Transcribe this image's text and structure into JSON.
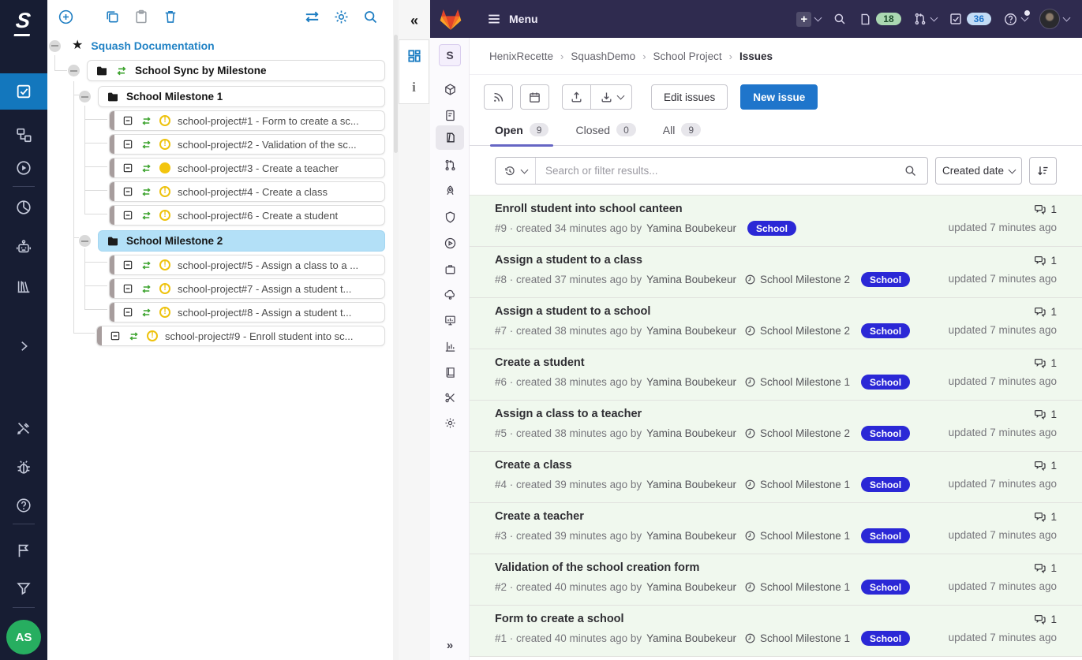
{
  "colors": {
    "gitlab_navbar": "#2f2b4f",
    "accent_blue": "#1f75cb",
    "label_blue": "#2b28d6",
    "row_green": "#f0f8ee",
    "squash_active_blue": "#1377bd",
    "tab_underline": "#6666c4",
    "sync_green": "#3da32f",
    "warn_yellow": "#eec20c"
  },
  "icons_text": {
    "collapse_left": "«",
    "expand_right": "»",
    "plus": "+",
    "info": "i",
    "breadcrumb_sep": "›"
  },
  "squash": {
    "logo_text": "S",
    "user_initials": "AS",
    "tree": {
      "root_label": "Squash Documentation",
      "sync_folder_label": "School Sync by Milestone",
      "milestones": [
        {
          "label": "School Milestone 1",
          "items": [
            {
              "label": "school-project#1 - Form to create a sc...",
              "status": "warn"
            },
            {
              "label": "school-project#2 - Validation of the sc...",
              "status": "warn"
            },
            {
              "label": "school-project#3 - Create a teacher",
              "status": "dot"
            },
            {
              "label": "school-project#4 - Create a class",
              "status": "warn"
            },
            {
              "label": "school-project#6 - Create a student",
              "status": "warn"
            }
          ]
        },
        {
          "label": "School Milestone 2",
          "items": [
            {
              "label": "school-project#5 - Assign a class to a ...",
              "status": "warn"
            },
            {
              "label": "school-project#7 - Assign a student t...",
              "status": "warn"
            },
            {
              "label": "school-project#8 - Assign a student t...",
              "status": "warn"
            }
          ]
        }
      ],
      "outer_item": {
        "label": "school-project#9 - Enroll student into sc...",
        "status": "warn"
      }
    }
  },
  "gitlab": {
    "navbar": {
      "menu_label": "Menu",
      "issues_count": "18",
      "todos_count": "36"
    },
    "project_avatar": "S",
    "breadcrumb": {
      "items": [
        "HenixRecette",
        "SquashDemo",
        "School Project",
        "Issues"
      ]
    },
    "actions": {
      "edit_issues": "Edit issues",
      "new_issue": "New issue"
    },
    "tabs": [
      {
        "label": "Open",
        "count": "9"
      },
      {
        "label": "Closed",
        "count": "0"
      },
      {
        "label": "All",
        "count": "9"
      }
    ],
    "filter": {
      "placeholder": "Search or filter results...",
      "sort_label": "Created date"
    },
    "issues": [
      {
        "title": "Enroll student into school canteen",
        "meta": "#9 · created 34 minutes ago by",
        "author": "Yamina Boubekeur",
        "milestone": null,
        "label": "School",
        "comments": "1",
        "updated": "updated 7 minutes ago"
      },
      {
        "title": "Assign a student to a class",
        "meta": "#8 · created 37 minutes ago by",
        "author": "Yamina Boubekeur",
        "milestone": "School Milestone 2",
        "label": "School",
        "comments": "1",
        "updated": "updated 7 minutes ago"
      },
      {
        "title": "Assign a student to a school",
        "meta": "#7 · created 38 minutes ago by",
        "author": "Yamina Boubekeur",
        "milestone": "School Milestone 2",
        "label": "School",
        "comments": "1",
        "updated": "updated 7 minutes ago"
      },
      {
        "title": "Create a student",
        "meta": "#6 · created 38 minutes ago by",
        "author": "Yamina Boubekeur",
        "milestone": "School Milestone 1",
        "label": "School",
        "comments": "1",
        "updated": "updated 7 minutes ago"
      },
      {
        "title": "Assign a class to a teacher",
        "meta": "#5 · created 38 minutes ago by",
        "author": "Yamina Boubekeur",
        "milestone": "School Milestone 2",
        "label": "School",
        "comments": "1",
        "updated": "updated 7 minutes ago"
      },
      {
        "title": "Create a class",
        "meta": "#4 · created 39 minutes ago by",
        "author": "Yamina Boubekeur",
        "milestone": "School Milestone 1",
        "label": "School",
        "comments": "1",
        "updated": "updated 7 minutes ago"
      },
      {
        "title": "Create a teacher",
        "meta": "#3 · created 39 minutes ago by",
        "author": "Yamina Boubekeur",
        "milestone": "School Milestone 1",
        "label": "School",
        "comments": "1",
        "updated": "updated 7 minutes ago"
      },
      {
        "title": "Validation of the school creation form",
        "meta": "#2 · created 40 minutes ago by",
        "author": "Yamina Boubekeur",
        "milestone": "School Milestone 1",
        "label": "School",
        "comments": "1",
        "updated": "updated 7 minutes ago"
      },
      {
        "title": "Form to create a school",
        "meta": "#1 · created 40 minutes ago by",
        "author": "Yamina Boubekeur",
        "milestone": "School Milestone 1",
        "label": "School",
        "comments": "1",
        "updated": "updated 7 minutes ago"
      }
    ]
  }
}
